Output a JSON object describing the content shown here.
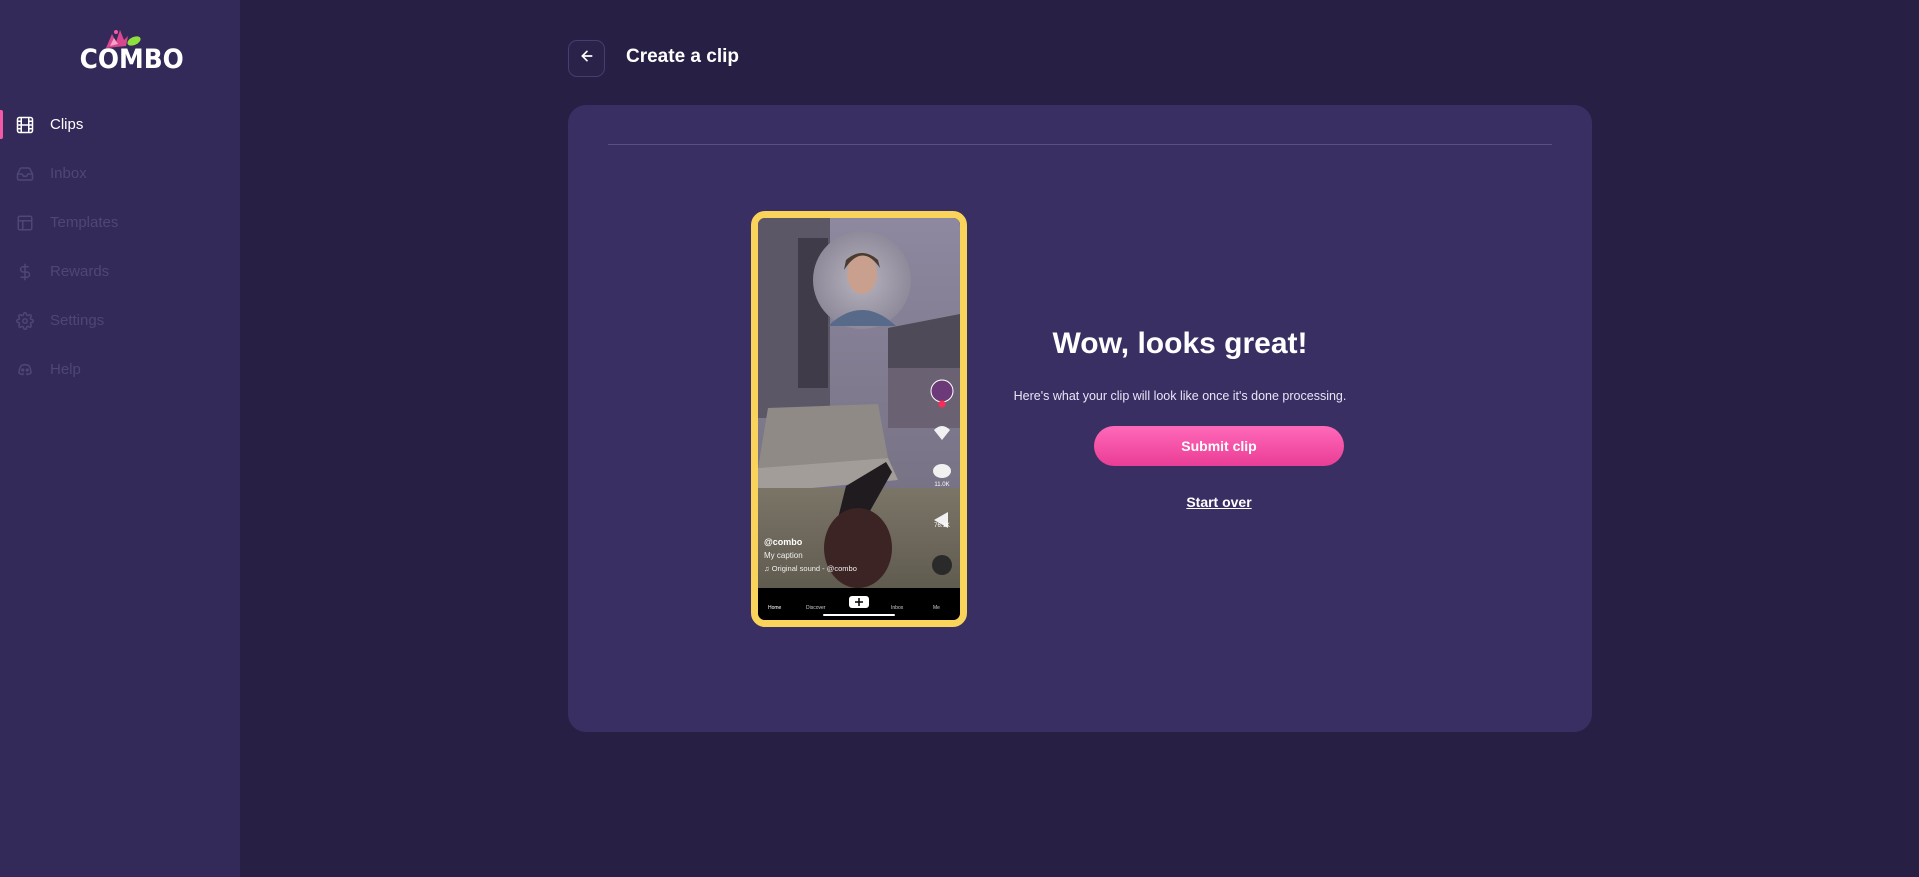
{
  "app": {
    "logo_text": "COMBO"
  },
  "sidebar": {
    "items": [
      {
        "label": "Clips",
        "icon": "film-icon",
        "active": true
      },
      {
        "label": "Inbox",
        "icon": "inbox-icon",
        "active": false
      },
      {
        "label": "Templates",
        "icon": "layout-icon",
        "active": false
      },
      {
        "label": "Rewards",
        "icon": "dollar-icon",
        "active": false
      },
      {
        "label": "Settings",
        "icon": "gear-icon",
        "active": false
      },
      {
        "label": "Help",
        "icon": "discord-icon",
        "active": false
      }
    ]
  },
  "header": {
    "title": "Create a clip",
    "back_icon": "arrow-left-icon"
  },
  "preview": {
    "username": "@combo",
    "caption": "My caption",
    "sound": "Original sound - @combo",
    "likes": "",
    "comments": "11.0K",
    "shares": "76.1K",
    "tabs": [
      "Home",
      "Discover",
      "",
      "Inbox",
      "Me"
    ]
  },
  "main": {
    "headline": "Wow, looks great!",
    "subtext": "Here's what your clip will look like once it's done processing.",
    "submit_label": "Submit clip",
    "start_over_label": "Start over"
  },
  "colors": {
    "background": "#272044",
    "sidebar": "#332a59",
    "card": "#3a2f63",
    "accent": "#f25aa8",
    "phone_frame": "#fad45a"
  }
}
